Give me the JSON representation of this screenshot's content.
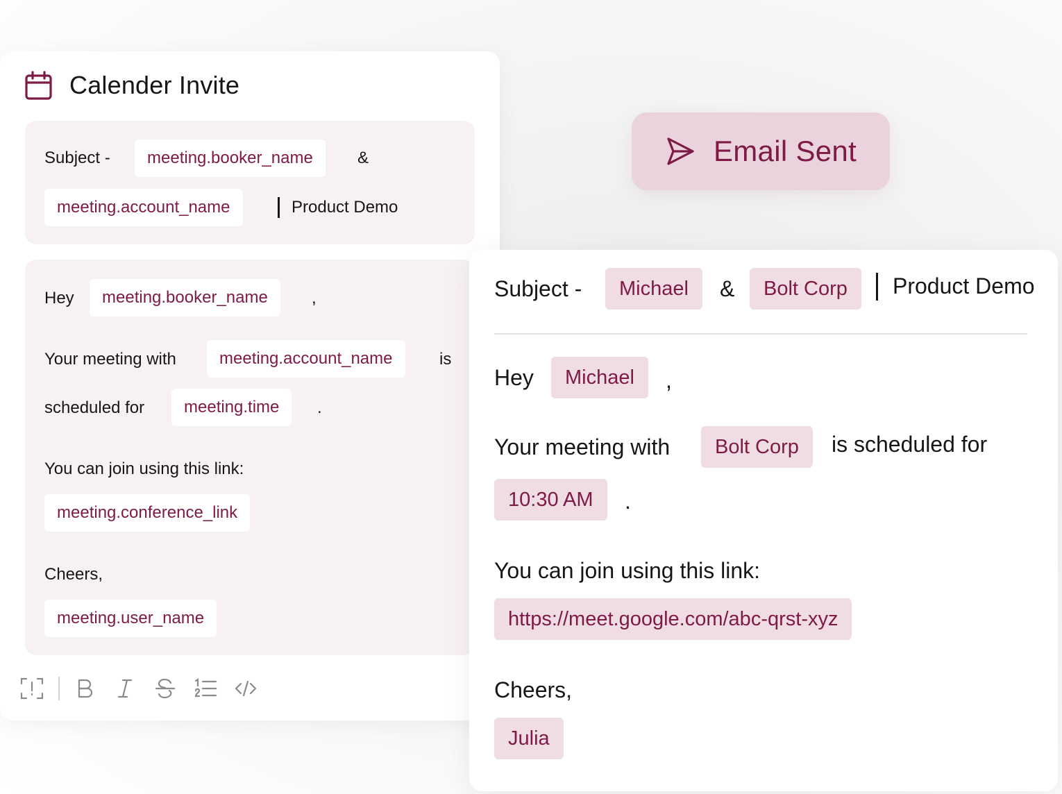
{
  "template": {
    "title": "Calender Invite",
    "subject": {
      "label": "Subject -",
      "var_booker": "meeting.booker_name",
      "amp": "&",
      "var_account": "meeting.account_name",
      "suffix": "Product Demo"
    },
    "body": {
      "greeting": "Hey",
      "var_booker": "meeting.booker_name",
      "comma": ",",
      "meeting_with": "Your meeting with",
      "var_account": "meeting.account_name",
      "is": "is",
      "scheduled_for": "scheduled for",
      "var_time": "meeting.time",
      "period": ".",
      "join_text": "You can join using this link:",
      "var_link": "meeting.conference_link",
      "signoff": "Cheers,",
      "var_user": "meeting.user_name"
    },
    "toolbar": [
      "variable-icon",
      "bold-icon",
      "italic-icon",
      "strikethrough-icon",
      "numbered-list-icon",
      "code-icon"
    ]
  },
  "status_button": {
    "label": "Email Sent",
    "icon": "send-icon"
  },
  "preview": {
    "subject": {
      "label": "Subject -",
      "name": "Michael",
      "amp": "&",
      "company": "Bolt Corp",
      "suffix": "Product Demo"
    },
    "body": {
      "greeting": "Hey",
      "name": "Michael",
      "comma": ",",
      "meeting_with": "Your meeting with",
      "company": "Bolt Corp",
      "scheduled_for": "is scheduled for",
      "time": "10:30 AM",
      "period": ".",
      "join_text": "You can join using this link:",
      "link": "https://meet.google.com/abc-qrst-xyz",
      "signoff": "Cheers,",
      "user": "Julia"
    }
  },
  "colors": {
    "accent": "#7d1a46",
    "chip_bg": "#efdde3",
    "button_bg": "#ead3dc",
    "template_bg": "#f8f1f2"
  }
}
